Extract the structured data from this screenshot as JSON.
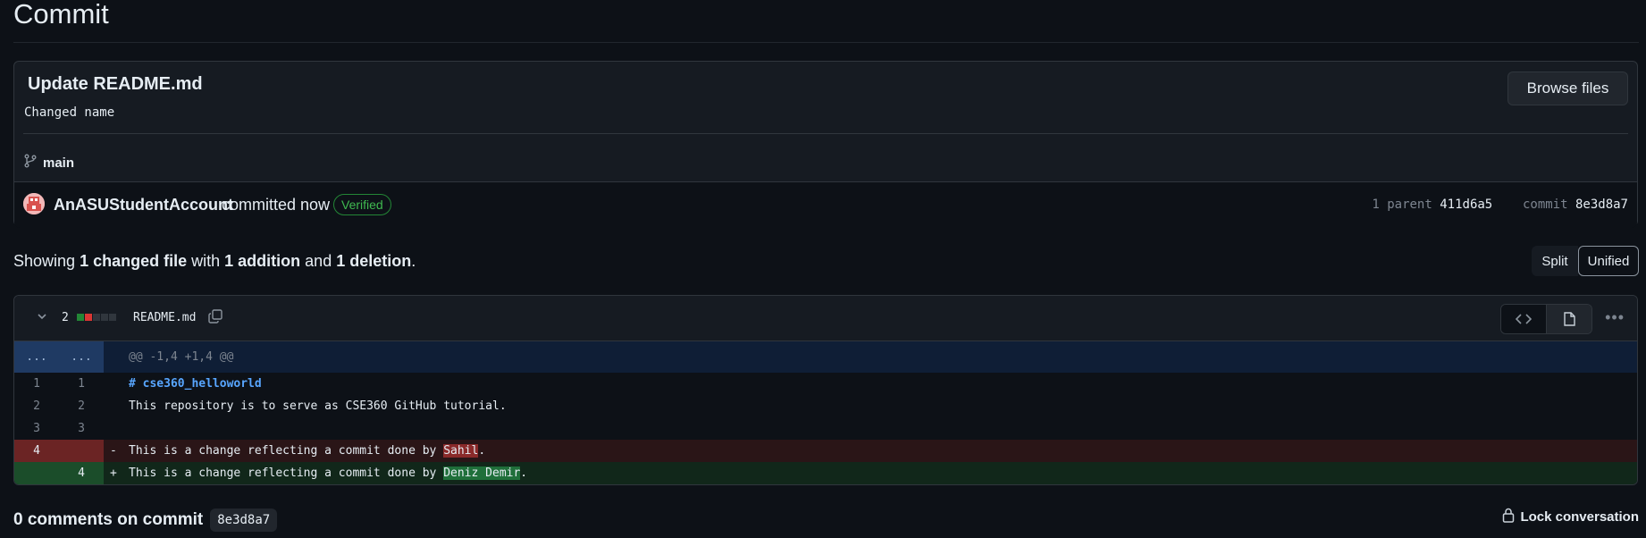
{
  "page": {
    "title": "Commit"
  },
  "commit": {
    "title": "Update README.md",
    "description": "Changed name",
    "browse_label": "Browse files",
    "branch": "main",
    "author": "AnASUStudentAccount",
    "committed_text": "committed now",
    "verified_label": "Verified",
    "parent_label": "1 parent",
    "parent_sha": "411d6a5",
    "commit_label": "commit",
    "commit_sha": "8e3d8a7"
  },
  "summary": {
    "prefix": "Showing",
    "files": "1 changed file",
    "with": "with",
    "additions": "1 addition",
    "and": "and",
    "deletions": "1 deletion",
    "suffix": "."
  },
  "view_toggle": {
    "split": "Split",
    "unified": "Unified",
    "selected": "Unified"
  },
  "file": {
    "change_count": "2",
    "name": "README.md",
    "hunk_old_dots": "...",
    "hunk_new_dots": "...",
    "hunk_header": "@@ -1,4 +1,4 @@",
    "lines": [
      {
        "old": "1",
        "new": "1",
        "sign": "",
        "code": "# cse360_helloworld"
      },
      {
        "old": "2",
        "new": "2",
        "sign": "",
        "code": "This repository is to serve as CSE360 GitHub tutorial."
      },
      {
        "old": "3",
        "new": "3",
        "sign": "",
        "code": ""
      },
      {
        "old": "4",
        "new": "",
        "sign": "-",
        "code_before": "This is a change reflecting a commit done by ",
        "code_highlight": "Sahil",
        "code_after": "."
      },
      {
        "old": "",
        "new": "4",
        "sign": "+",
        "code_before": "This is a change reflecting a commit done by ",
        "code_highlight": "Deniz Demir",
        "code_after": "."
      }
    ]
  },
  "comments": {
    "label": "0 comments on commit",
    "sha": "8e3d8a7",
    "lock_label": "Lock conversation"
  },
  "colors": {
    "background": "#0d1117",
    "addition": "#238636",
    "deletion": "#da3633",
    "verified": "#3fb950",
    "link": "#58a6ff"
  },
  "icons": [
    "git-branch-icon",
    "copy-icon",
    "chevron-down-icon",
    "code-icon",
    "file-icon",
    "kebab-horizontal-icon",
    "lock-icon"
  ]
}
